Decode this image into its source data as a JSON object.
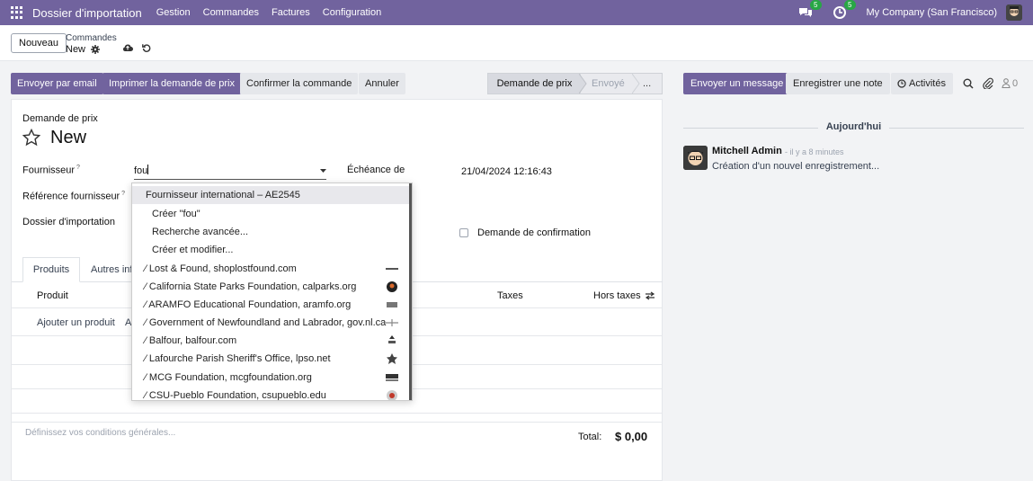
{
  "navbar": {
    "app_title": "Dossier d'importation",
    "menu": [
      "Gestion",
      "Commandes",
      "Factures",
      "Configuration"
    ],
    "chat_badge": "5",
    "activity_badge": "5",
    "company": "My Company (San Francisco)"
  },
  "control": {
    "new_button": "Nouveau",
    "breadcrumb_parent": "Commandes",
    "breadcrumb_current": "New"
  },
  "actions": {
    "send_email": "Envoyer par email",
    "print_rfq": "Imprimer la demande de prix",
    "confirm_order": "Confirmer la commande",
    "cancel": "Annuler"
  },
  "statusbar": {
    "stages": [
      "Demande de prix",
      "Envoyé",
      "..."
    ],
    "active": "Demande de prix"
  },
  "form": {
    "doc_type": "Demande de prix",
    "name": "New",
    "vendor_label": "Fournisseur",
    "vendor_value": "fou",
    "vendor_ref_label": "Référence fournisseur",
    "import_file_label": "Dossier d'importation",
    "deadline_label": "Échéance de",
    "deadline_value": "21/04/2024 12:16:43",
    "confirm_request_label": "Demande de confirmation",
    "tabs": [
      "Produits",
      "Autres inf"
    ],
    "columns": {
      "product": "Produit",
      "taxes": "Taxes",
      "excl_tax": "Hors taxes"
    },
    "add_product": "Ajouter un produit",
    "add_other": "A",
    "terms_placeholder": "Définissez vos conditions générales...",
    "total_label": "Total:",
    "total_value": "$ 0,00"
  },
  "dropdown": {
    "items": [
      {
        "label": "Fournisseur international – AE2545",
        "type": "option"
      },
      {
        "label": "Créer \"fou\"",
        "type": "action"
      },
      {
        "label": "Recherche avancée...",
        "type": "action"
      },
      {
        "label": "Créer et modifier...",
        "type": "action"
      },
      {
        "label": "Lost & Found, shoplostfound.com",
        "type": "enrich"
      },
      {
        "label": "California State Parks Foundation, calparks.org",
        "type": "enrich"
      },
      {
        "label": "ARAMFO Educational Foundation, aramfo.org",
        "type": "enrich"
      },
      {
        "label": "Government of Newfoundland and Labrador, gov.nl.ca",
        "type": "enrich"
      },
      {
        "label": "Balfour, balfour.com",
        "type": "enrich"
      },
      {
        "label": "Lafourche Parish Sheriff's Office, lpso.net",
        "type": "enrich"
      },
      {
        "label": "MCG Foundation, mcgfoundation.org",
        "type": "enrich"
      },
      {
        "label": "CSU-Pueblo Foundation, csupueblo.edu",
        "type": "enrich"
      }
    ]
  },
  "chatter": {
    "send_message": "Envoyer un message",
    "log_note": "Enregistrer une note",
    "activities": "Activités",
    "followers_count": "0",
    "today": "Aujourd'hui",
    "author": "Mitchell Admin",
    "time": "- il y a 8 minutes",
    "body": "Création d'un nouvel enregistrement..."
  },
  "colors": {
    "brand": "#71639e",
    "badge": "#28a745"
  }
}
